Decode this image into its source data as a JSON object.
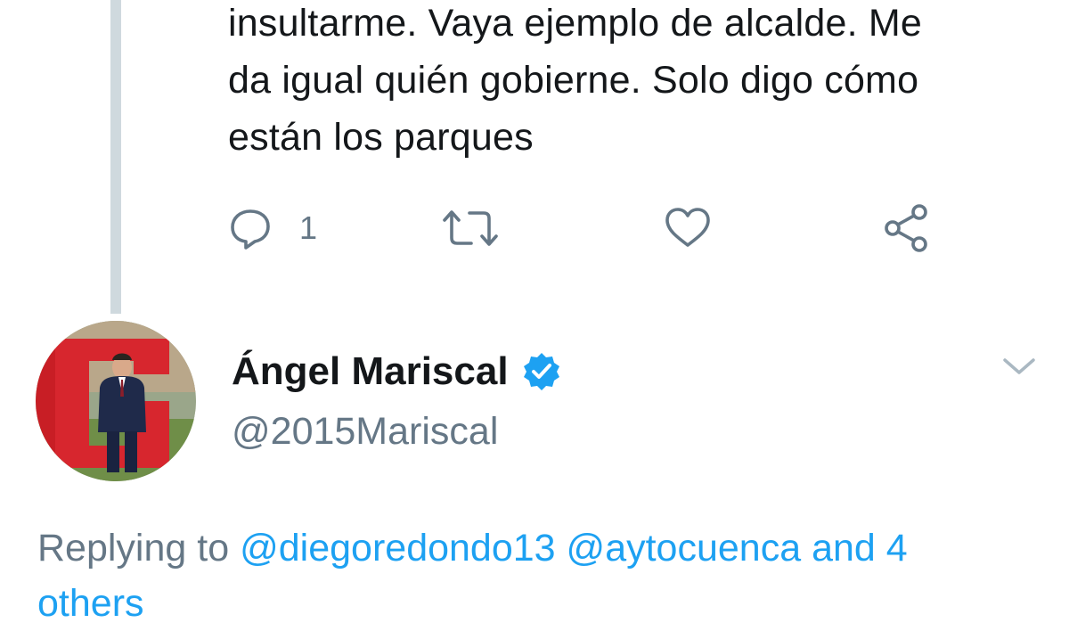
{
  "previous_tweet": {
    "text_lines": [
      "insultarme. Vaya ejemplo de alcalde. Me",
      "da igual quién gobierne. Solo digo cómo",
      "están los parques"
    ],
    "actions": {
      "reply_count": "1",
      "icons": [
        "reply-icon",
        "retweet-icon",
        "like-icon",
        "share-icon"
      ]
    }
  },
  "author": {
    "name": "Ángel Mariscal",
    "handle": "@2015Mariscal",
    "verified_icon": "verified-badge-icon"
  },
  "replying": {
    "prefix": "Replying to",
    "mention_1": "@diegoredondo13",
    "mention_2": "@aytocuenca",
    "suffix": "and 4",
    "second_line": "others"
  },
  "colors": {
    "accent": "#1da1f2",
    "muted": "#657786",
    "text": "#14171a",
    "thread_line": "#cfd9de"
  }
}
